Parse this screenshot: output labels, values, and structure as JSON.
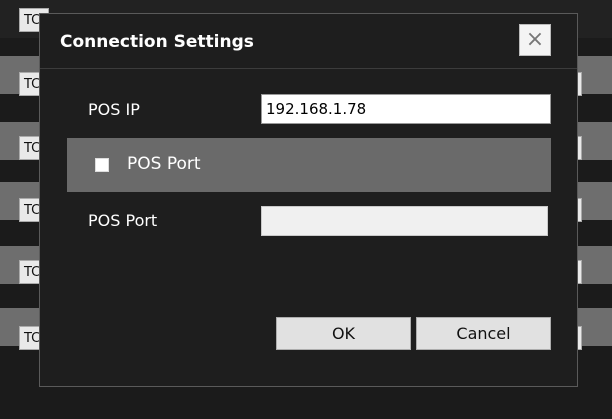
{
  "background": {
    "cell_labels": [
      "TC",
      "TC",
      "TC",
      "TC",
      "TC",
      "TC"
    ]
  },
  "dialog": {
    "title": "Connection Settings",
    "close_glyph": "×",
    "close_icon": "close-icon",
    "pos_ip_label": "POS IP",
    "pos_ip_value": "192.168.1.78",
    "checkbox_label": "POS Port",
    "checkbox_checked": false,
    "pos_port_label": "POS Port",
    "pos_port_value": "",
    "ok_label": "OK",
    "cancel_label": "Cancel"
  }
}
